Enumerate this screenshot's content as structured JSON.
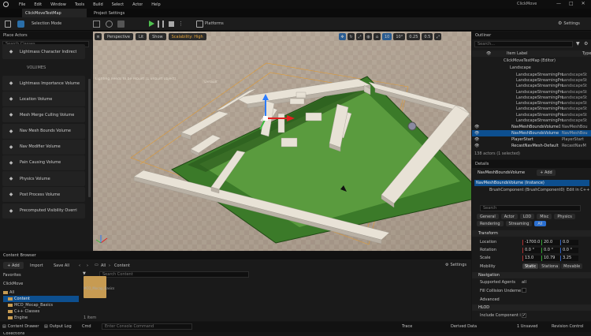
{
  "menu": {
    "items": [
      "File",
      "Edit",
      "Window",
      "Tools",
      "Build",
      "Select",
      "Actor",
      "Help"
    ],
    "project": "ClickMove",
    "map_tab": "ClickMoveTestMap",
    "settings_tab": "Project Settings"
  },
  "toolbar": {
    "save": "",
    "selection_mode": "Selection Mode",
    "platforms": "Platforms",
    "settings": "Settings"
  },
  "place": {
    "title": "Place Actors",
    "search": "Search Classes",
    "category": "VOLUMES",
    "items": [
      "Lightmass Character Indirect",
      "Lightmass Importance Volume",
      "Location Volume",
      "Mesh Merge Culling Volume",
      "Nav Mesh Bounds Volume",
      "Nav Modifier Volume",
      "Pain Causing Volume",
      "Physics Volume",
      "Post Process Volume",
      "Precomputed Visibility Overri"
    ]
  },
  "viewport": {
    "perspective": "Perspective",
    "lit": "Lit",
    "show": "Show",
    "scalability": "Scalability: High",
    "grid": "10",
    "rot": "10°",
    "scale": "0.25",
    "speed": "0.5",
    "overlay": [
      "Lighting needs to be rebuilt (1 unbuilt object)",
      "'Default'"
    ]
  },
  "outliner": {
    "title": "Outliner",
    "search": "Search...",
    "col_label": "Item Label",
    "col_type": "Type",
    "map": "ClickMoveTestMap (Editor)",
    "landscape": "Landscape",
    "rows": [
      "LandscapeStreamingPro",
      "LandscapeStreamingPro",
      "LandscapeStreamingPro",
      "LandscapeStreamingPro",
      "LandscapeStreamingPro",
      "LandscapeStreamingPro",
      "LandscapeStreamingPro",
      "LandscapeStreamingPro",
      "LandscapeStreamingPro"
    ],
    "row_types": [
      "LandscapeSt",
      "LandscapeSt",
      "LandscapeSt",
      "LandscapeSt",
      "LandscapeSt",
      "LandscapeSt",
      "LandscapeSt",
      "LandscapeSt",
      "LandscapeSt"
    ],
    "extra": [
      {
        "name": "NavMeshBoundsVolume1",
        "type": "NavMeshBou"
      },
      {
        "name": "NavMeshBoundsVolume",
        "type": "NavMeshBou"
      },
      {
        "name": "PlayerStart",
        "type": "PlayerStart"
      },
      {
        "name": "RecastNavMesh-Default",
        "type": "RecastNavM"
      }
    ],
    "count": "138 actors (1 selected)"
  },
  "details": {
    "title": "Details",
    "object": "NavMeshBoundsVolume",
    "add": "+ Add",
    "instance": "NavMeshBoundsVolume (Instance)",
    "component": "BrushComponent (BrushComponent0)",
    "edit": "Edit in C++",
    "search": "Search",
    "tabs1": [
      "General",
      "Actor",
      "LOD",
      "Misc",
      "Physics"
    ],
    "tabs2": [
      "Rendering",
      "Streaming",
      "All"
    ],
    "transform": "Transform",
    "location": "Location",
    "rotation": "Rotation",
    "scale": "Scale",
    "loc": [
      "-1700.0",
      "20.0",
      "0.0"
    ],
    "rot": [
      "0.0 °",
      "0.0 °",
      "0.0 °"
    ],
    "scl": [
      "13.0",
      "10.79",
      "3.25"
    ],
    "mobility": "Mobility",
    "mob_opts": [
      "Static",
      "Stationa",
      "Movable"
    ],
    "navigation": "Navigation",
    "supported": "Supported Agents",
    "supported_val": "all",
    "fill": "Fill Collision Underneath",
    "advanced": "Advanced",
    "hlod": "HLOD",
    "include": "Include Component in"
  },
  "browser": {
    "title": "Content Browser",
    "add": "+ Add",
    "import": "Import",
    "save_all": "Save All",
    "path": [
      "All",
      "Content"
    ],
    "settings": "Settings",
    "search": "Search Content",
    "favorites": "Favorites",
    "root": "ClickMove",
    "tree": [
      "All",
      "Content",
      "MCO_Mocap_Basics",
      "C++ Classes",
      "Engine"
    ],
    "folder": "MCO_Mocap_Basics",
    "items": "1 item",
    "collections": "Collections"
  },
  "status": {
    "drawer": "Content Drawer",
    "output": "Output Log",
    "cmd": "Cmd",
    "console": "Enter Console Command",
    "trace": "Trace",
    "derived": "Derived Data",
    "unsaved": "1 Unsaved",
    "revision": "Revision Control"
  }
}
